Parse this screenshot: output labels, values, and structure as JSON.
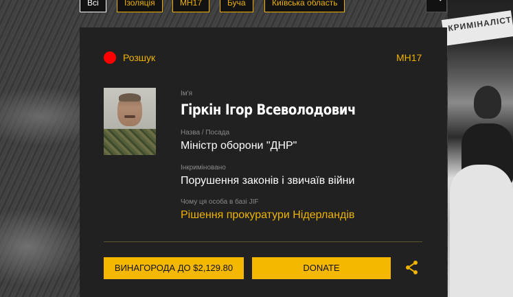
{
  "filters": [
    {
      "label": "Всі",
      "active": true
    },
    {
      "label": "Ізоляція",
      "active": false
    },
    {
      "label": "MH17",
      "active": false
    },
    {
      "label": "Буча",
      "active": false
    },
    {
      "label": "Київська область",
      "active": false
    }
  ],
  "background": {
    "sign_text": "КРИМІНАЛІСТИЧН"
  },
  "card": {
    "status": "Розшук",
    "case_tag": "MH17",
    "name_label": "Ім'я",
    "name": "Гіркін Ігор Всеволодович",
    "position_label": "Назва / Посада",
    "position": "Міністр оборони \"ДНР\"",
    "charge_label": "Інкриміновано",
    "charge": "Порушення законів і звичаїв війни",
    "reason_label": "Чому ця особа в базі JIF",
    "reason": "Рішення прокуратури Нідерландів",
    "reward_button": "ВИНАГОРОДА ДО $2,129.80",
    "donate_button": "DONATE"
  },
  "colors": {
    "accent": "#f0b400",
    "status_dot": "#ff0000",
    "card_bg": "#212121"
  },
  "icons": {
    "search": "search-icon",
    "share": "share-icon"
  }
}
